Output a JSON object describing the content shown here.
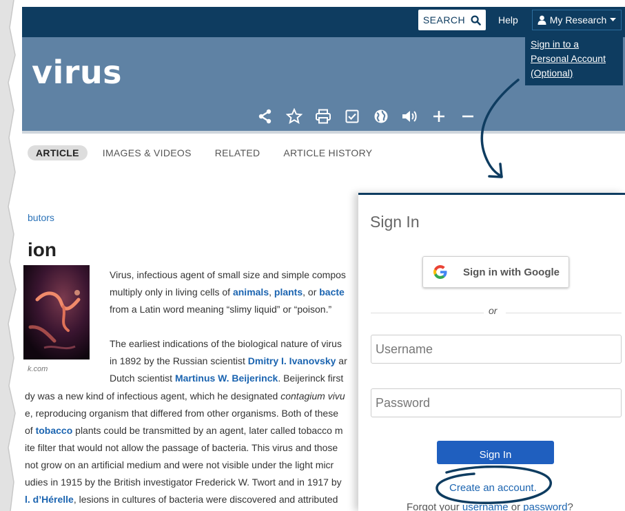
{
  "header": {
    "search_label": "SEARCH",
    "help_label": "Help",
    "my_research_label": "My Research",
    "dropdown_link": "Sign in to a Personal Account (Optional)",
    "page_title": "virus",
    "tools": [
      "share-icon",
      "star-icon",
      "print-icon",
      "checkbox-icon",
      "globe-icon",
      "speaker-icon",
      "plus-icon",
      "minus-icon"
    ]
  },
  "tabs": [
    "ARTICLE",
    "IMAGES & VIDEOS",
    "RELATED",
    "ARTICLE HISTORY"
  ],
  "article": {
    "contributors_fragment": "butors",
    "section_heading_fragment": "ion",
    "caption_fragment": "k.com",
    "lines": [
      {
        "pre": "Virus, infectious agent of small size and simple compos"
      },
      {
        "pre": "multiply only in living cells of ",
        "link1": "animals",
        "mid1": ", ",
        "link2": "plants",
        "mid2": ", or ",
        "link3": "bacte"
      },
      {
        "pre": "from a Latin word meaning “slimy liquid” or “poison.”"
      },
      {
        "pre": "The earliest indications of the biological nature of virus"
      },
      {
        "pre": "in 1892 by the Russian scientist ",
        "link1": "Dmitry I. Ivanovsky",
        "mid1": " ar"
      },
      {
        "pre": "Dutch scientist ",
        "link1": "Martinus W. Beijerinck",
        "mid1": ". Beijerinck first"
      },
      {
        "pre": "dy was a new kind of infectious agent, which he designated ",
        "em": "contagium vivu"
      },
      {
        "pre": "e, reproducing organism that differed from other organisms. Both of these"
      },
      {
        "pre": "of ",
        "link1": "tobacco",
        "mid1": " plants could be transmitted by an agent, later called tobacco m"
      },
      {
        "pre": "ite filter that would not allow the passage of bacteria. This virus and those"
      },
      {
        "pre": "not grow on an artificial medium and were not visible under the light micr"
      },
      {
        "pre": "udies in 1915 by the British investigator Frederick W. Twort and in 1917 by"
      },
      {
        "pre": "",
        "link1": "l. d’Hérelle",
        "mid1": ", lesions in cultures of bacteria were discovered and attributed"
      }
    ]
  },
  "signin": {
    "title": "Sign In",
    "google_label": "Sign in with Google",
    "or_label": "or",
    "username_placeholder": "Username",
    "password_placeholder": "Password",
    "signin_button": "Sign In",
    "create_account": "Create an account.",
    "forgot_prefix": "Forgot your ",
    "username_link": "username",
    "forgot_mid": " or ",
    "password_link": "password",
    "forgot_suffix": "?"
  },
  "colors": {
    "topbar": "#0e3c60",
    "title_band": "#5f82a4",
    "link": "#1b64b0",
    "signin_button": "#1f5fbf",
    "annotation": "#0e3c60"
  }
}
